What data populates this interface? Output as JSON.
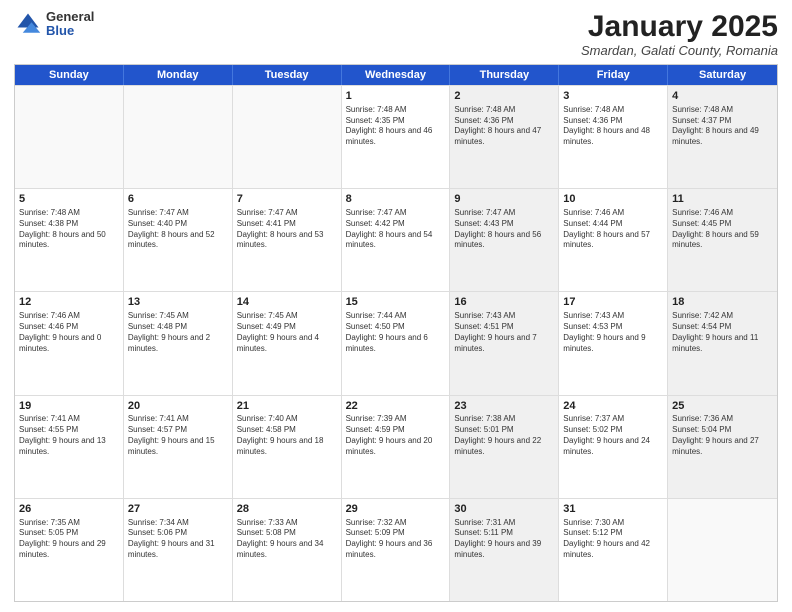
{
  "logo": {
    "general": "General",
    "blue": "Blue"
  },
  "header": {
    "month": "January 2025",
    "location": "Smardan, Galati County, Romania"
  },
  "weekdays": [
    "Sunday",
    "Monday",
    "Tuesday",
    "Wednesday",
    "Thursday",
    "Friday",
    "Saturday"
  ],
  "rows": [
    [
      {
        "day": "",
        "sunrise": "",
        "sunset": "",
        "daylight": "",
        "shaded": false,
        "empty": true
      },
      {
        "day": "",
        "sunrise": "",
        "sunset": "",
        "daylight": "",
        "shaded": false,
        "empty": true
      },
      {
        "day": "",
        "sunrise": "",
        "sunset": "",
        "daylight": "",
        "shaded": false,
        "empty": true
      },
      {
        "day": "1",
        "sunrise": "Sunrise: 7:48 AM",
        "sunset": "Sunset: 4:35 PM",
        "daylight": "Daylight: 8 hours and 46 minutes.",
        "shaded": false,
        "empty": false
      },
      {
        "day": "2",
        "sunrise": "Sunrise: 7:48 AM",
        "sunset": "Sunset: 4:36 PM",
        "daylight": "Daylight: 8 hours and 47 minutes.",
        "shaded": true,
        "empty": false
      },
      {
        "day": "3",
        "sunrise": "Sunrise: 7:48 AM",
        "sunset": "Sunset: 4:36 PM",
        "daylight": "Daylight: 8 hours and 48 minutes.",
        "shaded": false,
        "empty": false
      },
      {
        "day": "4",
        "sunrise": "Sunrise: 7:48 AM",
        "sunset": "Sunset: 4:37 PM",
        "daylight": "Daylight: 8 hours and 49 minutes.",
        "shaded": true,
        "empty": false
      }
    ],
    [
      {
        "day": "5",
        "sunrise": "Sunrise: 7:48 AM",
        "sunset": "Sunset: 4:38 PM",
        "daylight": "Daylight: 8 hours and 50 minutes.",
        "shaded": false,
        "empty": false
      },
      {
        "day": "6",
        "sunrise": "Sunrise: 7:47 AM",
        "sunset": "Sunset: 4:40 PM",
        "daylight": "Daylight: 8 hours and 52 minutes.",
        "shaded": false,
        "empty": false
      },
      {
        "day": "7",
        "sunrise": "Sunrise: 7:47 AM",
        "sunset": "Sunset: 4:41 PM",
        "daylight": "Daylight: 8 hours and 53 minutes.",
        "shaded": false,
        "empty": false
      },
      {
        "day": "8",
        "sunrise": "Sunrise: 7:47 AM",
        "sunset": "Sunset: 4:42 PM",
        "daylight": "Daylight: 8 hours and 54 minutes.",
        "shaded": false,
        "empty": false
      },
      {
        "day": "9",
        "sunrise": "Sunrise: 7:47 AM",
        "sunset": "Sunset: 4:43 PM",
        "daylight": "Daylight: 8 hours and 56 minutes.",
        "shaded": true,
        "empty": false
      },
      {
        "day": "10",
        "sunrise": "Sunrise: 7:46 AM",
        "sunset": "Sunset: 4:44 PM",
        "daylight": "Daylight: 8 hours and 57 minutes.",
        "shaded": false,
        "empty": false
      },
      {
        "day": "11",
        "sunrise": "Sunrise: 7:46 AM",
        "sunset": "Sunset: 4:45 PM",
        "daylight": "Daylight: 8 hours and 59 minutes.",
        "shaded": true,
        "empty": false
      }
    ],
    [
      {
        "day": "12",
        "sunrise": "Sunrise: 7:46 AM",
        "sunset": "Sunset: 4:46 PM",
        "daylight": "Daylight: 9 hours and 0 minutes.",
        "shaded": false,
        "empty": false
      },
      {
        "day": "13",
        "sunrise": "Sunrise: 7:45 AM",
        "sunset": "Sunset: 4:48 PM",
        "daylight": "Daylight: 9 hours and 2 minutes.",
        "shaded": false,
        "empty": false
      },
      {
        "day": "14",
        "sunrise": "Sunrise: 7:45 AM",
        "sunset": "Sunset: 4:49 PM",
        "daylight": "Daylight: 9 hours and 4 minutes.",
        "shaded": false,
        "empty": false
      },
      {
        "day": "15",
        "sunrise": "Sunrise: 7:44 AM",
        "sunset": "Sunset: 4:50 PM",
        "daylight": "Daylight: 9 hours and 6 minutes.",
        "shaded": false,
        "empty": false
      },
      {
        "day": "16",
        "sunrise": "Sunrise: 7:43 AM",
        "sunset": "Sunset: 4:51 PM",
        "daylight": "Daylight: 9 hours and 7 minutes.",
        "shaded": true,
        "empty": false
      },
      {
        "day": "17",
        "sunrise": "Sunrise: 7:43 AM",
        "sunset": "Sunset: 4:53 PM",
        "daylight": "Daylight: 9 hours and 9 minutes.",
        "shaded": false,
        "empty": false
      },
      {
        "day": "18",
        "sunrise": "Sunrise: 7:42 AM",
        "sunset": "Sunset: 4:54 PM",
        "daylight": "Daylight: 9 hours and 11 minutes.",
        "shaded": true,
        "empty": false
      }
    ],
    [
      {
        "day": "19",
        "sunrise": "Sunrise: 7:41 AM",
        "sunset": "Sunset: 4:55 PM",
        "daylight": "Daylight: 9 hours and 13 minutes.",
        "shaded": false,
        "empty": false
      },
      {
        "day": "20",
        "sunrise": "Sunrise: 7:41 AM",
        "sunset": "Sunset: 4:57 PM",
        "daylight": "Daylight: 9 hours and 15 minutes.",
        "shaded": false,
        "empty": false
      },
      {
        "day": "21",
        "sunrise": "Sunrise: 7:40 AM",
        "sunset": "Sunset: 4:58 PM",
        "daylight": "Daylight: 9 hours and 18 minutes.",
        "shaded": false,
        "empty": false
      },
      {
        "day": "22",
        "sunrise": "Sunrise: 7:39 AM",
        "sunset": "Sunset: 4:59 PM",
        "daylight": "Daylight: 9 hours and 20 minutes.",
        "shaded": false,
        "empty": false
      },
      {
        "day": "23",
        "sunrise": "Sunrise: 7:38 AM",
        "sunset": "Sunset: 5:01 PM",
        "daylight": "Daylight: 9 hours and 22 minutes.",
        "shaded": true,
        "empty": false
      },
      {
        "day": "24",
        "sunrise": "Sunrise: 7:37 AM",
        "sunset": "Sunset: 5:02 PM",
        "daylight": "Daylight: 9 hours and 24 minutes.",
        "shaded": false,
        "empty": false
      },
      {
        "day": "25",
        "sunrise": "Sunrise: 7:36 AM",
        "sunset": "Sunset: 5:04 PM",
        "daylight": "Daylight: 9 hours and 27 minutes.",
        "shaded": true,
        "empty": false
      }
    ],
    [
      {
        "day": "26",
        "sunrise": "Sunrise: 7:35 AM",
        "sunset": "Sunset: 5:05 PM",
        "daylight": "Daylight: 9 hours and 29 minutes.",
        "shaded": false,
        "empty": false
      },
      {
        "day": "27",
        "sunrise": "Sunrise: 7:34 AM",
        "sunset": "Sunset: 5:06 PM",
        "daylight": "Daylight: 9 hours and 31 minutes.",
        "shaded": false,
        "empty": false
      },
      {
        "day": "28",
        "sunrise": "Sunrise: 7:33 AM",
        "sunset": "Sunset: 5:08 PM",
        "daylight": "Daylight: 9 hours and 34 minutes.",
        "shaded": false,
        "empty": false
      },
      {
        "day": "29",
        "sunrise": "Sunrise: 7:32 AM",
        "sunset": "Sunset: 5:09 PM",
        "daylight": "Daylight: 9 hours and 36 minutes.",
        "shaded": false,
        "empty": false
      },
      {
        "day": "30",
        "sunrise": "Sunrise: 7:31 AM",
        "sunset": "Sunset: 5:11 PM",
        "daylight": "Daylight: 9 hours and 39 minutes.",
        "shaded": true,
        "empty": false
      },
      {
        "day": "31",
        "sunrise": "Sunrise: 7:30 AM",
        "sunset": "Sunset: 5:12 PM",
        "daylight": "Daylight: 9 hours and 42 minutes.",
        "shaded": false,
        "empty": false
      },
      {
        "day": "",
        "sunrise": "",
        "sunset": "",
        "daylight": "",
        "shaded": true,
        "empty": true
      }
    ]
  ]
}
